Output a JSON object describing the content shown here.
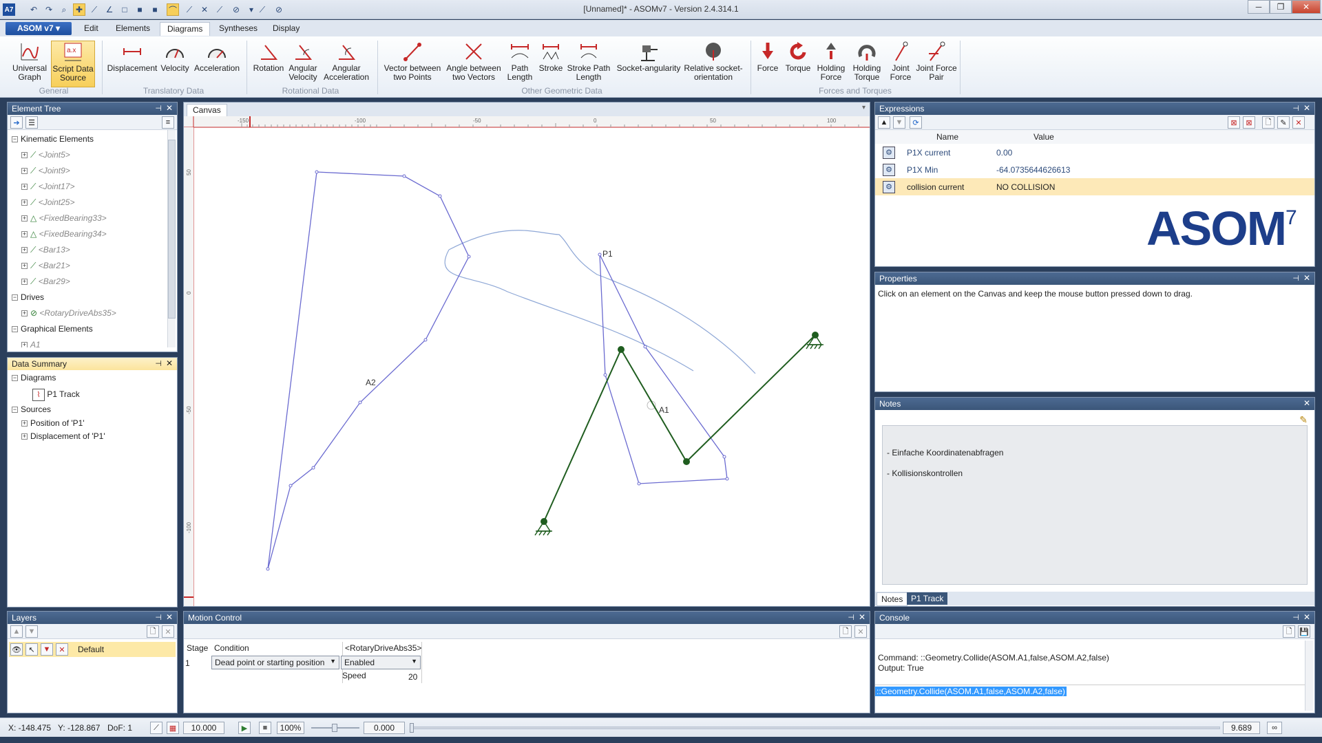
{
  "window": {
    "title": "[Unnamed]* - ASOMv7 - Version 2.4.314.1"
  },
  "menu": {
    "app": "ASOM v7 ▾",
    "items": [
      "Edit",
      "Elements",
      "Diagrams",
      "Syntheses",
      "Display"
    ],
    "active": "Diagrams"
  },
  "ribbon": {
    "buttons": [
      {
        "label": "Universal Graph"
      },
      {
        "label": "Script Data Source"
      },
      {
        "label": "Displacement"
      },
      {
        "label": "Velocity"
      },
      {
        "label": "Acceleration"
      },
      {
        "label": "Rotation"
      },
      {
        "label": "Angular Velocity"
      },
      {
        "label": "Angular Acceleration"
      },
      {
        "label": "Vector between two Points"
      },
      {
        "label": "Angle between two Vectors"
      },
      {
        "label": "Path Length"
      },
      {
        "label": "Stroke"
      },
      {
        "label": "Stroke Path Length"
      },
      {
        "label": "Socket-angularity"
      },
      {
        "label": "Relative socket-orientation"
      },
      {
        "label": "Force"
      },
      {
        "label": "Torque"
      },
      {
        "label": "Holding Force"
      },
      {
        "label": "Holding Torque"
      },
      {
        "label": "Joint Force"
      },
      {
        "label": "Joint Force Pair"
      }
    ],
    "groups": [
      "General",
      "Translatory Data",
      "Rotational Data",
      "Other Geometric Data",
      "Forces and Torques"
    ]
  },
  "element_tree": {
    "title": "Element Tree",
    "sections": [
      {
        "label": "Kinematic Elements",
        "items": [
          "<Joint5>",
          "<Joint9>",
          "<Joint17>",
          "<Joint25>",
          "<FixedBearing33>",
          "<FixedBearing34>",
          "<Bar13>",
          "<Bar21>",
          "<Bar29>"
        ]
      },
      {
        "label": "Drives",
        "items": [
          "<RotaryDriveAbs35>"
        ]
      },
      {
        "label": "Graphical Elements",
        "items": [
          "A1"
        ]
      }
    ]
  },
  "data_summary": {
    "title": "Data Summary",
    "diagrams_label": "Diagrams",
    "diagram": "P1 Track",
    "sources_label": "Sources",
    "sources": [
      "Position of 'P1'",
      "Displacement of 'P1'"
    ]
  },
  "canvas": {
    "tab": "Canvas",
    "ruler_ticks": [
      "-150",
      "-100",
      "-50",
      "0",
      "50",
      "100"
    ],
    "vruler_ticks": [
      "50",
      "0",
      "-50",
      "-100"
    ],
    "labels": {
      "a2": "A2",
      "a1": "A1",
      "p1": "P1"
    }
  },
  "expressions": {
    "title": "Expressions",
    "col_name": "Name",
    "col_value": "Value",
    "rows": [
      {
        "name": "P1X current",
        "value": "0.00"
      },
      {
        "name": "P1X Min",
        "value": "-64.0735644626613"
      },
      {
        "name": "collision current",
        "value": "NO COLLISION"
      }
    ],
    "logo": "ASOM",
    "logo_sup": "7"
  },
  "properties": {
    "title": "Properties",
    "text": "Click on an element on the Canvas and keep the mouse button pressed down to drag."
  },
  "notes": {
    "title": "Notes",
    "lines": [
      "- Einfache Koordinatenabfragen",
      "- Kollisionskontrollen"
    ],
    "tabs": [
      "Notes",
      "P1 Track"
    ]
  },
  "layers": {
    "title": "Layers",
    "item": "Default"
  },
  "motion": {
    "title": "Motion Control",
    "col_stage": "Stage",
    "col_condition": "Condition",
    "col_drive": "<RotaryDriveAbs35>",
    "stage": "1",
    "condition": "Dead point or starting position",
    "enabled": "Enabled",
    "speed_label": "Speed",
    "speed": "20"
  },
  "console": {
    "title": "Console",
    "command": "Command: ::Geometry.Collide(ASOM.A1,false,ASOM.A2,false)",
    "output": "Output: True",
    "input": "::Geometry.Collide(ASOM.A1,false,ASOM.A2,false)"
  },
  "status": {
    "x": "X: -148.475",
    "y": "Y: -128.867",
    "dof": "DoF: 1",
    "grid": "10.000",
    "zoom": "100%",
    "time": "0.000",
    "end": "9.689"
  }
}
